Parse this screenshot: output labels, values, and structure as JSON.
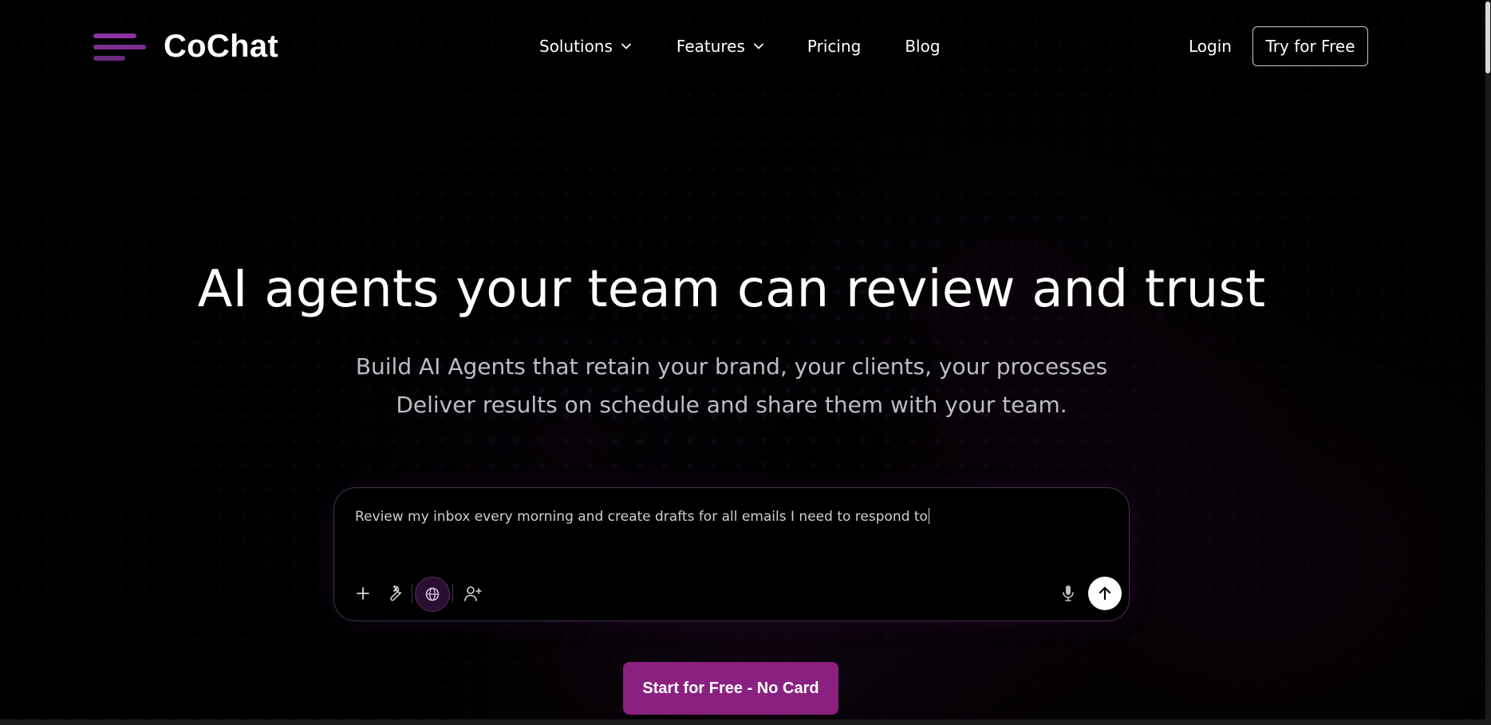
{
  "brand": {
    "name": "CoChat",
    "accent": "#8a2180"
  },
  "nav": {
    "items": [
      {
        "label": "Solutions",
        "has_dropdown": true
      },
      {
        "label": "Features",
        "has_dropdown": true
      },
      {
        "label": "Pricing",
        "has_dropdown": false
      },
      {
        "label": "Blog",
        "has_dropdown": false
      }
    ],
    "login_label": "Login",
    "try_label": "Try for Free"
  },
  "hero": {
    "title": "AI agents your team can review and trust",
    "subtitle_line1": "Build AI Agents that retain your brand, your clients, your processes",
    "subtitle_line2": "Deliver results on schedule and share them with your team."
  },
  "prompt": {
    "text": "Review my inbox every morning and create drafts for all emails I need to respond to",
    "tools": [
      "plus-icon",
      "wrench-icon",
      "globe-icon",
      "add-user-icon"
    ],
    "right_tools": [
      "microphone-icon",
      "send-arrow-icon"
    ]
  },
  "cta": {
    "label": "Start for Free - No Card"
  }
}
